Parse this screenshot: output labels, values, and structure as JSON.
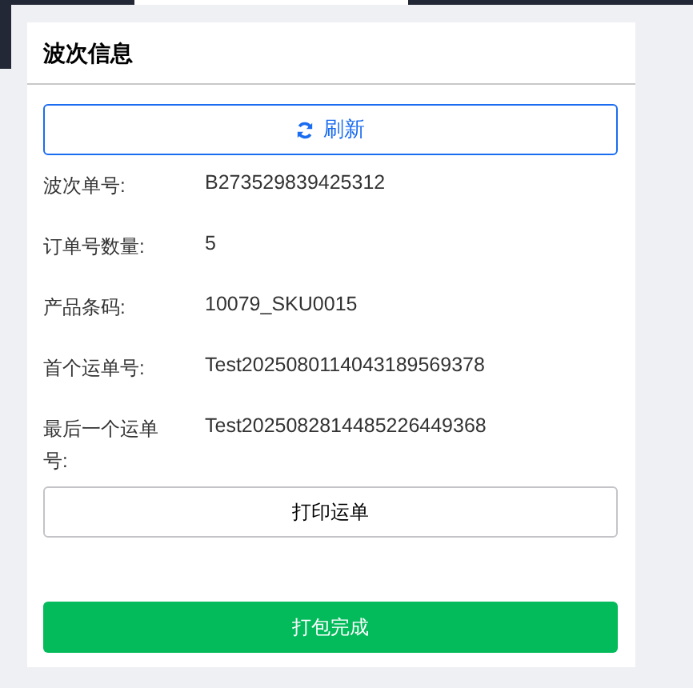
{
  "panel": {
    "title": "波次信息"
  },
  "refresh_button": {
    "label": "刷新"
  },
  "fields": [
    {
      "label": "波次单号:",
      "value": "B273529839425312"
    },
    {
      "label": "订单号数量:",
      "value": "5"
    },
    {
      "label": "产品条码:",
      "value": "10079_SKU0015"
    },
    {
      "label": "首个运单号:",
      "value": "Test2025080114043189569378"
    },
    {
      "label": "最后一个运单号:",
      "value": "Test2025082814485226449368"
    }
  ],
  "print_button": {
    "label": "打印运单"
  },
  "finish_button": {
    "label": "打包完成"
  }
}
